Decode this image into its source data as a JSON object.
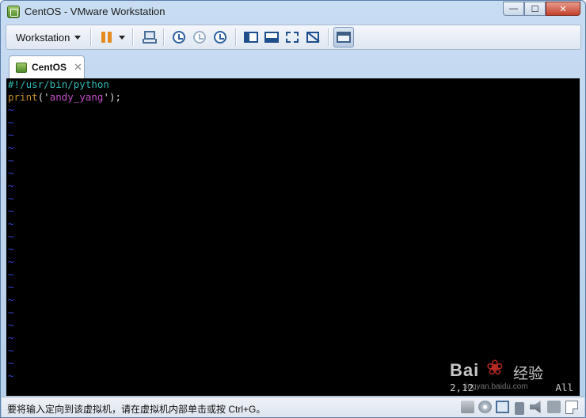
{
  "window": {
    "title": "CentOS - VMware Workstation",
    "controls": {
      "minimize": "—",
      "maximize": "☐",
      "close": "✕"
    }
  },
  "toolbar": {
    "workstation_label": "Workstation",
    "icons": [
      "pause-icon",
      "send-ctrl-alt-del-icon",
      "snapshot-icon",
      "revert-snapshot-icon",
      "snapshot-manager-icon",
      "view-sidebar-icon",
      "view-thumbnail-icon",
      "fullscreen-icon",
      "unity-icon",
      "console-view-icon"
    ]
  },
  "tabs": [
    {
      "label": "CentOS",
      "close": "✕"
    }
  ],
  "console": {
    "lines": [
      {
        "shebang": "#!/usr/bin/python"
      },
      {
        "fn": "print",
        "open": "('",
        "str": "andy_yang",
        "close": "');"
      }
    ],
    "tilde": "~",
    "cursor_position": "2,12",
    "scope": "All"
  },
  "statusbar": {
    "message": "要将输入定向到该虚拟机，请在虚拟机内部单击或按 Ctrl+G。",
    "device_icons": [
      "hard-disk-icon",
      "cd-dvd-icon",
      "network-adapter-icon",
      "usb-icon",
      "sound-card-icon",
      "printer-icon"
    ]
  },
  "watermark": {
    "brand": "Bai",
    "paw": "❀",
    "name": "经验",
    "url": "jingyan.baidu.com"
  },
  "colors": {
    "shebang": "#2fb9b0",
    "keyword": "#c0902a",
    "string": "#c24fc6",
    "tilde": "#3345d6",
    "console_bg": "#000000",
    "pause": "#e58a1f"
  }
}
